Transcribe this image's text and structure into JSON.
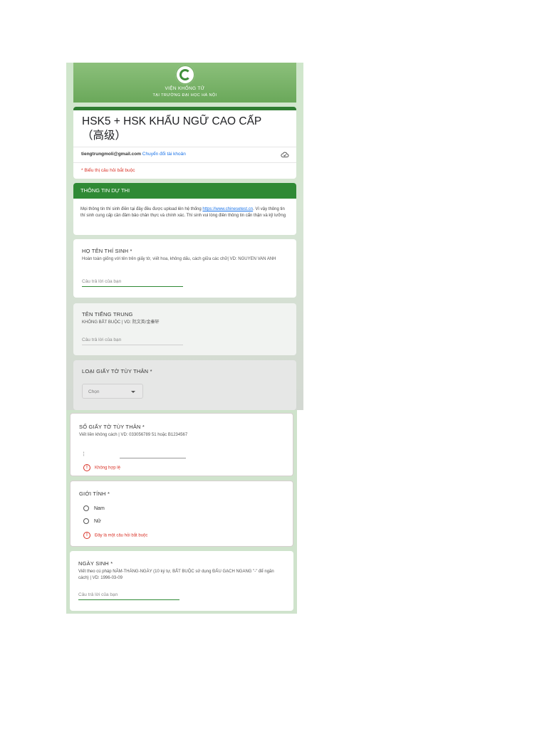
{
  "header": {
    "org_line1": "VIỆN KHỔNG TỬ",
    "org_line2": "TẠI TRƯỜNG ĐẠI HỌC HÀ NỘI"
  },
  "form": {
    "title": "HSK5 + HSK KHẨU NGỮ CAO CẤP（高级）",
    "account_email": "tiengtrungmoli@gmail.com",
    "switch_account": "Chuyển đổi tài khoản",
    "required_note": "* Biểu thị câu hỏi bắt buộc"
  },
  "section": {
    "header": "THÔNG TIN DỰ THI",
    "text_before_link": "Mọi thông tin thí sinh điền tại đây đều được upload lên hệ thống ",
    "link": "https://www.chinesetest.cn",
    "text_after_link": ". Vì vậy thông tin thí sinh cung cấp cần đảm bảo chân thực và chính xác. Thí sinh vui lòng điền thông tin cẩn thận và kỹ lưỡng"
  },
  "questions": {
    "full_name": {
      "label": "HỌ TÊN THÍ SINH *",
      "desc": "Hoàn toàn giống với tên trên giấy tờ, viết hoa, không dấu, cách giữa các chữ| VD: NGUYEN VAN ANH",
      "placeholder": "Câu trả lời của bạn"
    },
    "chinese_name": {
      "label": "TÊN TIẾNG TRUNG",
      "desc": "KHÔNG BẮT BUỘC | VD: 阮文英/金秦轩",
      "placeholder": "Câu trả lời của bạn"
    },
    "id_type": {
      "label": "LOẠI GIẤY TỜ TÙY THÂN *",
      "select_value": "Chọn"
    },
    "id_number": {
      "label": "SỐ GIẤY TỜ TÙY THÂN *",
      "desc": "Viết liền không cách | VD: 033056789 51 hoặc B1234567",
      "error": "Không hợp lệ"
    },
    "gender": {
      "label": "GIỚI TÍNH *",
      "options": [
        "Nam",
        "Nữ"
      ],
      "error": "Đây là một câu hỏi bắt buộc"
    },
    "birthday": {
      "label": "NGÀY SINH *",
      "desc": "Viết theo cú pháp NĂM-THÁNG-NGÀY (10 ký tự, BẮT BUỘC sử dụng ĐẤU GẠCH NGANG \"-\" để ngăn cách) | VD: 1996-03-09",
      "placeholder": "Câu trả lời của bạn"
    }
  },
  "colors": {
    "brand_green": "#2f8a35",
    "error_red": "#d93025",
    "link_blue": "#1a73e8"
  },
  "icons": [
    "institute-logo-icon",
    "cloud-save-icon",
    "dropdown-caret-icon",
    "error-icon",
    "radio-icon"
  ]
}
